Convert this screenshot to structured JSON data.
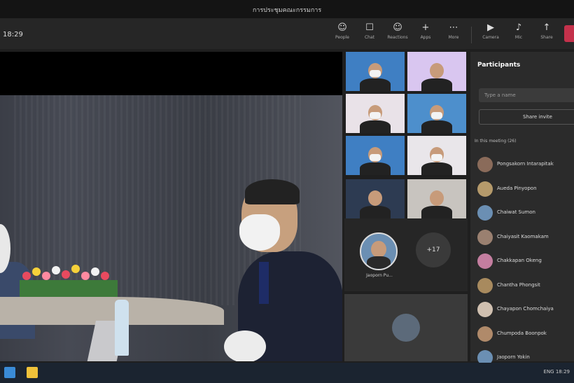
{
  "window": {
    "title": "การประชุมคณะกรรมการ"
  },
  "toolbar": {
    "timer": "18:29",
    "buttons": [
      {
        "label": "People",
        "icon": "people-icon",
        "glyph": "☺"
      },
      {
        "label": "Chat",
        "icon": "chat-icon",
        "glyph": "☐"
      },
      {
        "label": "Reactions",
        "icon": "reactions-icon",
        "glyph": "☺"
      },
      {
        "label": "Apps",
        "icon": "apps-icon",
        "glyph": "+"
      },
      {
        "label": "More",
        "icon": "more-icon",
        "glyph": "⋯"
      },
      {
        "label": "Camera",
        "icon": "camera-icon",
        "glyph": "▶"
      },
      {
        "label": "Mic",
        "icon": "mic-icon",
        "glyph": "♪"
      },
      {
        "label": "Share",
        "icon": "share-icon",
        "glyph": "↑"
      }
    ],
    "accent": "#c4314b"
  },
  "grid": {
    "tiles": [
      {
        "bg": "#3f7fc3"
      },
      {
        "bg": "#d9c6f0"
      },
      {
        "bg": "#e9e2e8"
      },
      {
        "bg": "#4d8fcc"
      },
      {
        "bg": "#3f7fc3"
      },
      {
        "bg": "#e9e6ea"
      },
      {
        "bg": "#2d3b52"
      },
      {
        "bg": "#c8c4bf"
      }
    ]
  },
  "self_panel": {
    "avatar_name": "Jaoporn Pu...",
    "more_count": "+17"
  },
  "sidebar": {
    "title": "Participants",
    "search_placeholder": "Type a name",
    "share_invite": "Share invite",
    "section": "In this meeting (26)",
    "participants": [
      {
        "name": "Pongsakorn Intarapitak",
        "color": "#8a6b5a"
      },
      {
        "name": "Aueda Pinyopon",
        "color": "#b59a6b"
      },
      {
        "name": "Chaiwat Sumon",
        "color": "#6b8fb3"
      },
      {
        "name": "Chaiyasit Kaomakam",
        "color": "#9a8070"
      },
      {
        "name": "Chakkapan Okeng",
        "color": "#c47ea0"
      },
      {
        "name": "Chantha Phongsit",
        "color": "#a88a5e"
      },
      {
        "name": "Chayapon Chomchaiya",
        "color": "#d0c0b0"
      },
      {
        "name": "Chumpoda Boonpok",
        "color": "#b08a6a"
      },
      {
        "name": "Jaoporn Yokin",
        "color": "#6b8fb3"
      }
    ]
  },
  "taskbar": {
    "tray": "ENG 18:29"
  }
}
